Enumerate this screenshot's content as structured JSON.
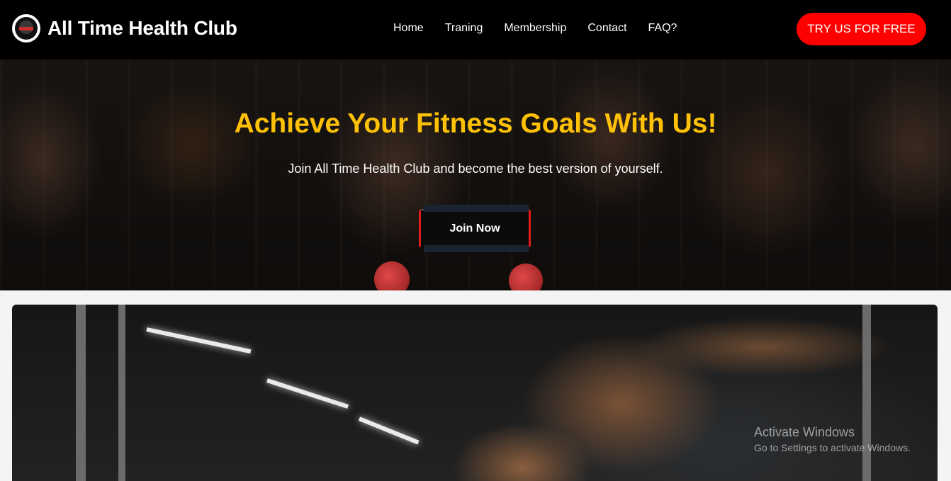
{
  "header": {
    "brand": "All Time Health Club",
    "nav": [
      {
        "label": "Home"
      },
      {
        "label": "Traning"
      },
      {
        "label": "Membership"
      },
      {
        "label": "Contact"
      },
      {
        "label": "FAQ?"
      }
    ],
    "cta_label": "TRY US FOR FREE"
  },
  "hero": {
    "title": "Achieve Your Fitness Goals With Us!",
    "subtitle": "Join All Time Health Club and become the best version of yourself.",
    "button_label": "Join Now"
  },
  "watermark": {
    "line1": "Activate Windows",
    "line2": "Go to Settings to activate Windows."
  },
  "colors": {
    "accent_red": "#ff0000",
    "title_yellow": "#ffc107",
    "nav_bg": "#000000"
  }
}
